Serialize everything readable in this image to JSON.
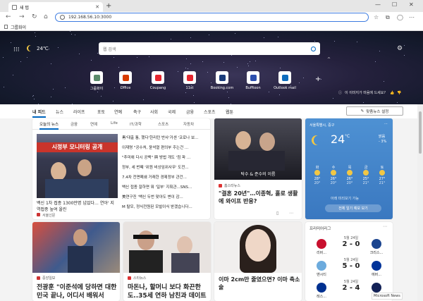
{
  "browser": {
    "tab_title": "새 탭",
    "tab_close": "✕",
    "new_tab": "+",
    "url": "192.168.56.10:3000",
    "favorites_folder": "그룹화이",
    "win_min": "—",
    "win_max": "☐",
    "win_close": "✕"
  },
  "hero": {
    "temperature": "24",
    "temp_unit": "℃",
    "search_placeholder": "웹 검색",
    "quick_links": [
      {
        "label": "그룹화이",
        "color": "#5a8a6a"
      },
      {
        "label": "Office",
        "color": "#d83b01"
      },
      {
        "label": "Coupang",
        "color": "#e5262f"
      },
      {
        "label": "11st",
        "color": "#e5262f"
      },
      {
        "label": "Booking.com",
        "color": "#1a3b7a"
      },
      {
        "label": "Bufftoon",
        "color": "#2c4fae"
      },
      {
        "label": "Outlook mail",
        "color": "#0f6cbd"
      }
    ],
    "image_question": "이 이미지가 마음에 드세요?"
  },
  "nav": {
    "items": [
      "내 피드",
      "뉴스",
      "라이프",
      "포토",
      "연예",
      "축구",
      "사회",
      "국제",
      "금융",
      "스포츠",
      "웹툰"
    ],
    "news_settings": "맞춤뉴스 설정"
  },
  "top_news": {
    "subtabs": [
      "오늘의 뉴스",
      "금융",
      "연예",
      "Life",
      "IT/과학",
      "스포츠",
      "자동차"
    ],
    "banner": "시정부 모니터링 공개",
    "headline": "백신 1차 접종 1300만명 넘었다… 연아' 지역접종 높여 올린",
    "source": "서울신문",
    "headlines": [
      "靑'대출 통, 했다'한리턴 반사'거센 '코로나 보...",
      "이재명 \"공수처, 윤석열 편의부 주는건 …",
      "\"추미애 다시 공백\" 與 방법 개도 '컴 파 ...",
      "정부, 세 번째 '위원 비상임위사무' 도전...",
      "7.4차 전면폐쇄 거래한 경제정부 관건...",
      "백신 접종 잘하면 뭐 '일부' 지휘관...SNS...",
      "美연구진 '백신 두번 맞아도 변이 감...",
      "M 탈모, 정식전원된 모발이식 받겠습니다..."
    ],
    "ad_label": "AD"
  },
  "news_card_1": {
    "image_caption": "탁수 & 준수의 이름",
    "source": "홈스타뉴스",
    "title": "\"결혼 20년\"…이종혁, 홀로 생활에 와이프 반응?"
  },
  "weather": {
    "location": "서울특별시, 중구",
    "temperature": "24",
    "unit": "°C",
    "condition": "맑음",
    "detail": "- 3%",
    "days": [
      {
        "label": "화",
        "high": "28°",
        "low": "20°"
      },
      {
        "label": "수",
        "high": "26°",
        "low": "20°"
      },
      {
        "label": "목",
        "high": "26°",
        "low": "20°"
      },
      {
        "label": "금",
        "high": "25°",
        "low": "21°"
      },
      {
        "label": "토",
        "high": "27°",
        "low": "21°"
      }
    ],
    "extra": "아래 미리보기 가능",
    "button": "전체 일기 예보 보기"
  },
  "row2": {
    "card_a": {
      "source": "중앙일보",
      "title": "전광훈 \"이준석에 당하면 대한민국 끝나, 어디서 배워서"
    },
    "card_b": {
      "source": "스타뉴스",
      "title": "마돈나, 할머니 보다 화끈한 도..35세 연하 남친과 데이트"
    },
    "card_c": {
      "source": "",
      "title": "이마 2cm만 줄였으면? 이마 축소술"
    }
  },
  "matches": {
    "header": "프리미어리그",
    "list": [
      {
        "date": "5월 24일",
        "score": "2 - 0",
        "home": "리버...",
        "away": "크리스..."
      },
      {
        "date": "5월 24일",
        "score": "5 - 0",
        "home": "맨시티",
        "away": "에버..."
      },
      {
        "date": "5월 24일",
        "score": "2 - 4",
        "home": "레스...",
        "away": "토트넘"
      }
    ]
  },
  "footer": {
    "brand": "Microsoft News"
  },
  "colors": {
    "accent": "#0067c0",
    "weather_bg": "#4a8bd0"
  }
}
